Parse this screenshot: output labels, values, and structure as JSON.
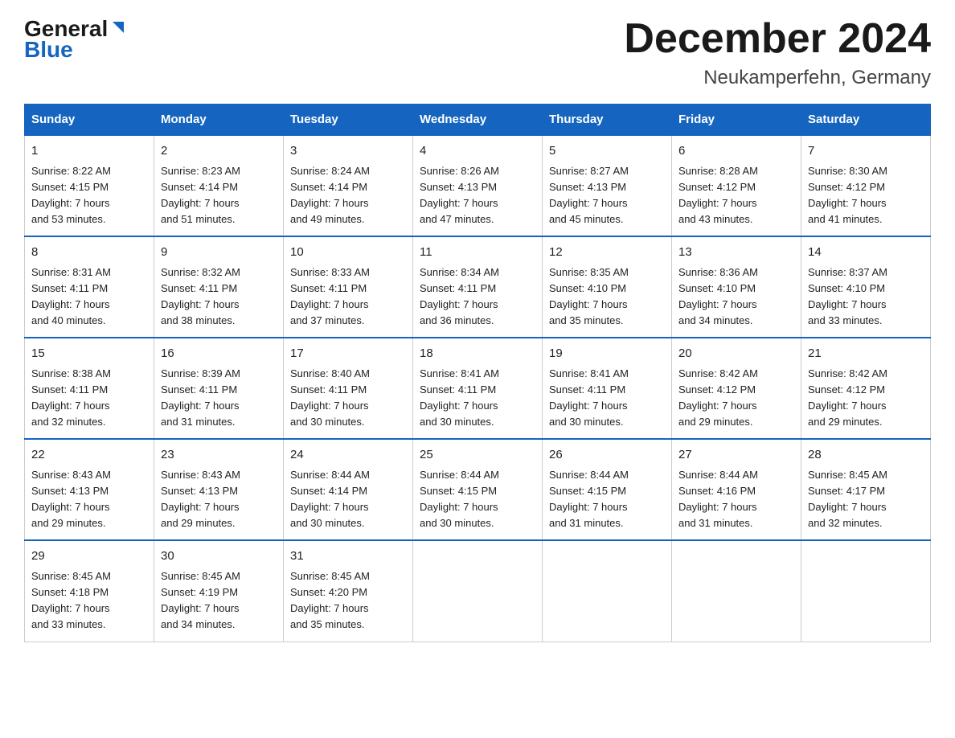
{
  "header": {
    "logo_line1": "General",
    "logo_line2": "Blue",
    "title": "December 2024",
    "subtitle": "Neukamperfehn, Germany"
  },
  "days_of_week": [
    "Sunday",
    "Monday",
    "Tuesday",
    "Wednesday",
    "Thursday",
    "Friday",
    "Saturday"
  ],
  "weeks": [
    [
      {
        "day": "1",
        "sunrise": "8:22 AM",
        "sunset": "4:15 PM",
        "daylight": "7 hours and 53 minutes."
      },
      {
        "day": "2",
        "sunrise": "8:23 AM",
        "sunset": "4:14 PM",
        "daylight": "7 hours and 51 minutes."
      },
      {
        "day": "3",
        "sunrise": "8:24 AM",
        "sunset": "4:14 PM",
        "daylight": "7 hours and 49 minutes."
      },
      {
        "day": "4",
        "sunrise": "8:26 AM",
        "sunset": "4:13 PM",
        "daylight": "7 hours and 47 minutes."
      },
      {
        "day": "5",
        "sunrise": "8:27 AM",
        "sunset": "4:13 PM",
        "daylight": "7 hours and 45 minutes."
      },
      {
        "day": "6",
        "sunrise": "8:28 AM",
        "sunset": "4:12 PM",
        "daylight": "7 hours and 43 minutes."
      },
      {
        "day": "7",
        "sunrise": "8:30 AM",
        "sunset": "4:12 PM",
        "daylight": "7 hours and 41 minutes."
      }
    ],
    [
      {
        "day": "8",
        "sunrise": "8:31 AM",
        "sunset": "4:11 PM",
        "daylight": "7 hours and 40 minutes."
      },
      {
        "day": "9",
        "sunrise": "8:32 AM",
        "sunset": "4:11 PM",
        "daylight": "7 hours and 38 minutes."
      },
      {
        "day": "10",
        "sunrise": "8:33 AM",
        "sunset": "4:11 PM",
        "daylight": "7 hours and 37 minutes."
      },
      {
        "day": "11",
        "sunrise": "8:34 AM",
        "sunset": "4:11 PM",
        "daylight": "7 hours and 36 minutes."
      },
      {
        "day": "12",
        "sunrise": "8:35 AM",
        "sunset": "4:10 PM",
        "daylight": "7 hours and 35 minutes."
      },
      {
        "day": "13",
        "sunrise": "8:36 AM",
        "sunset": "4:10 PM",
        "daylight": "7 hours and 34 minutes."
      },
      {
        "day": "14",
        "sunrise": "8:37 AM",
        "sunset": "4:10 PM",
        "daylight": "7 hours and 33 minutes."
      }
    ],
    [
      {
        "day": "15",
        "sunrise": "8:38 AM",
        "sunset": "4:11 PM",
        "daylight": "7 hours and 32 minutes."
      },
      {
        "day": "16",
        "sunrise": "8:39 AM",
        "sunset": "4:11 PM",
        "daylight": "7 hours and 31 minutes."
      },
      {
        "day": "17",
        "sunrise": "8:40 AM",
        "sunset": "4:11 PM",
        "daylight": "7 hours and 30 minutes."
      },
      {
        "day": "18",
        "sunrise": "8:41 AM",
        "sunset": "4:11 PM",
        "daylight": "7 hours and 30 minutes."
      },
      {
        "day": "19",
        "sunrise": "8:41 AM",
        "sunset": "4:11 PM",
        "daylight": "7 hours and 30 minutes."
      },
      {
        "day": "20",
        "sunrise": "8:42 AM",
        "sunset": "4:12 PM",
        "daylight": "7 hours and 29 minutes."
      },
      {
        "day": "21",
        "sunrise": "8:42 AM",
        "sunset": "4:12 PM",
        "daylight": "7 hours and 29 minutes."
      }
    ],
    [
      {
        "day": "22",
        "sunrise": "8:43 AM",
        "sunset": "4:13 PM",
        "daylight": "7 hours and 29 minutes."
      },
      {
        "day": "23",
        "sunrise": "8:43 AM",
        "sunset": "4:13 PM",
        "daylight": "7 hours and 29 minutes."
      },
      {
        "day": "24",
        "sunrise": "8:44 AM",
        "sunset": "4:14 PM",
        "daylight": "7 hours and 30 minutes."
      },
      {
        "day": "25",
        "sunrise": "8:44 AM",
        "sunset": "4:15 PM",
        "daylight": "7 hours and 30 minutes."
      },
      {
        "day": "26",
        "sunrise": "8:44 AM",
        "sunset": "4:15 PM",
        "daylight": "7 hours and 31 minutes."
      },
      {
        "day": "27",
        "sunrise": "8:44 AM",
        "sunset": "4:16 PM",
        "daylight": "7 hours and 31 minutes."
      },
      {
        "day": "28",
        "sunrise": "8:45 AM",
        "sunset": "4:17 PM",
        "daylight": "7 hours and 32 minutes."
      }
    ],
    [
      {
        "day": "29",
        "sunrise": "8:45 AM",
        "sunset": "4:18 PM",
        "daylight": "7 hours and 33 minutes."
      },
      {
        "day": "30",
        "sunrise": "8:45 AM",
        "sunset": "4:19 PM",
        "daylight": "7 hours and 34 minutes."
      },
      {
        "day": "31",
        "sunrise": "8:45 AM",
        "sunset": "4:20 PM",
        "daylight": "7 hours and 35 minutes."
      },
      null,
      null,
      null,
      null
    ]
  ],
  "labels": {
    "sunrise": "Sunrise:",
    "sunset": "Sunset:",
    "daylight": "Daylight:"
  }
}
